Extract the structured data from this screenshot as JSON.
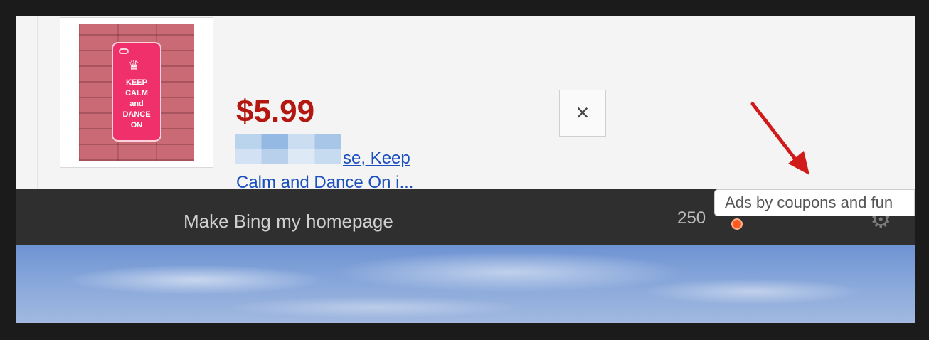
{
  "ad": {
    "phone_case_text": "KEEP\nCALM\nand\nDANCE\nON",
    "price": "$5.99",
    "title_line1": "se, Keep",
    "title_line2": "Calm and Dance On i...",
    "close_label": "×"
  },
  "bar": {
    "homepage_link": "Make Bing my homepage",
    "count": "250"
  },
  "tooltip": {
    "text": "Ads by coupons and fun"
  },
  "icons": {
    "close": "close-icon",
    "gear": "gear-icon",
    "arrow": "red-arrow-icon",
    "dot": "status-dot-icon"
  },
  "colors": {
    "price": "#b3170f",
    "link": "#1a4fbd",
    "arrow": "#d11a1a",
    "bar": "#2f2f2f",
    "dot": "#ff5a1f"
  }
}
